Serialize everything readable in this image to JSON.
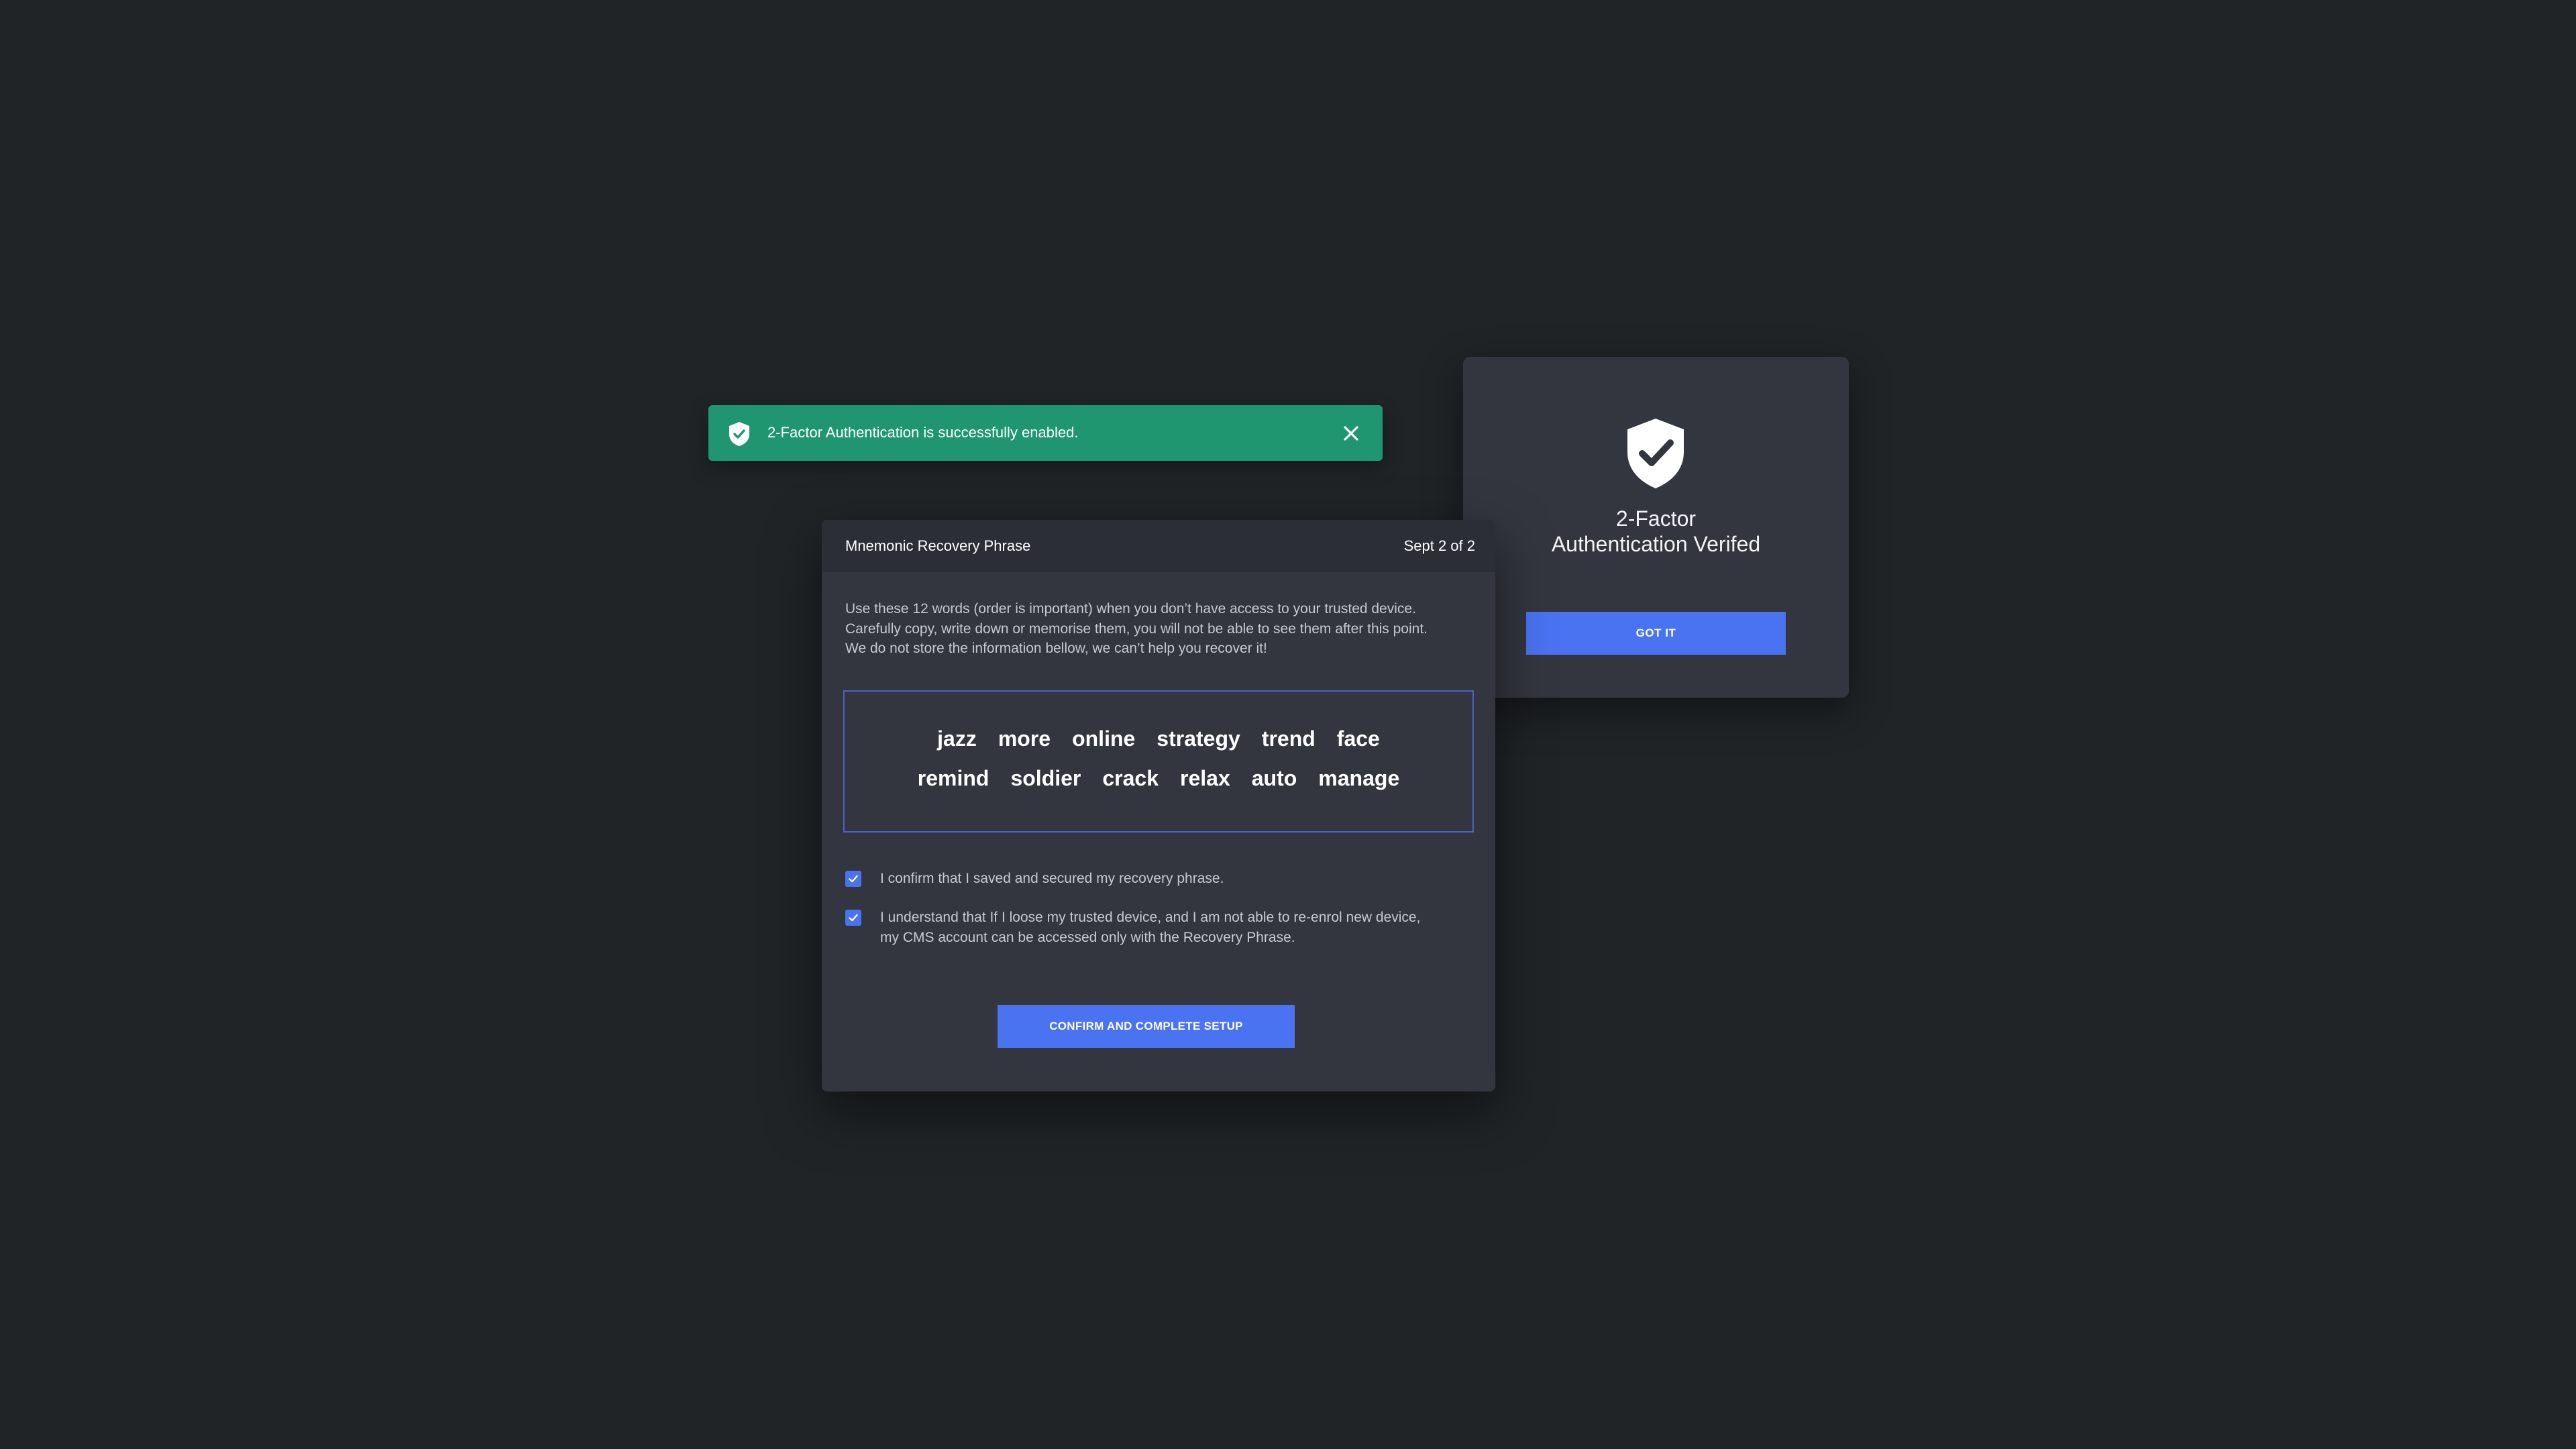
{
  "colors": {
    "background": "#202427",
    "card": "#33363e",
    "header": "#2b2e35",
    "accent": "#4a73f2",
    "success": "#1f9670"
  },
  "verified_card": {
    "icon": "shield-check-icon",
    "title_line1": "2-Factor",
    "title_line2": "Authentication Verifed",
    "button_label": "GOT IT"
  },
  "toast": {
    "icon": "shield-check-icon",
    "message": "2-Factor Authentication is successfully enabled.",
    "close_icon": "close-icon"
  },
  "modal": {
    "title": "Mnemonic Recovery Phrase",
    "step": "Sept 2 of 2",
    "description": [
      "Use these 12 words (order is important) when you don’t have access to your trusted device.",
      "Carefully copy, write down or memorise them, you will not be able to see them after this point.",
      "We do not store the information bellow, we can’t help you recover it!"
    ],
    "phrase_row1": [
      "jazz",
      "more",
      "online",
      "strategy",
      "trend",
      "face"
    ],
    "phrase_row2": [
      "remind",
      "soldier",
      "crack",
      "relax",
      "auto",
      "manage"
    ],
    "checkboxes": [
      {
        "checked": true,
        "lines": [
          "I confirm that I saved and secured my recovery phrase."
        ]
      },
      {
        "checked": true,
        "lines": [
          "I understand that If I loose my trusted device, and I am not able to re-enrol new device,",
          "my CMS account can be accessed only with the Recovery Phrase."
        ]
      }
    ],
    "confirm_label": "CONFIRM AND COMPLETE SETUP"
  }
}
